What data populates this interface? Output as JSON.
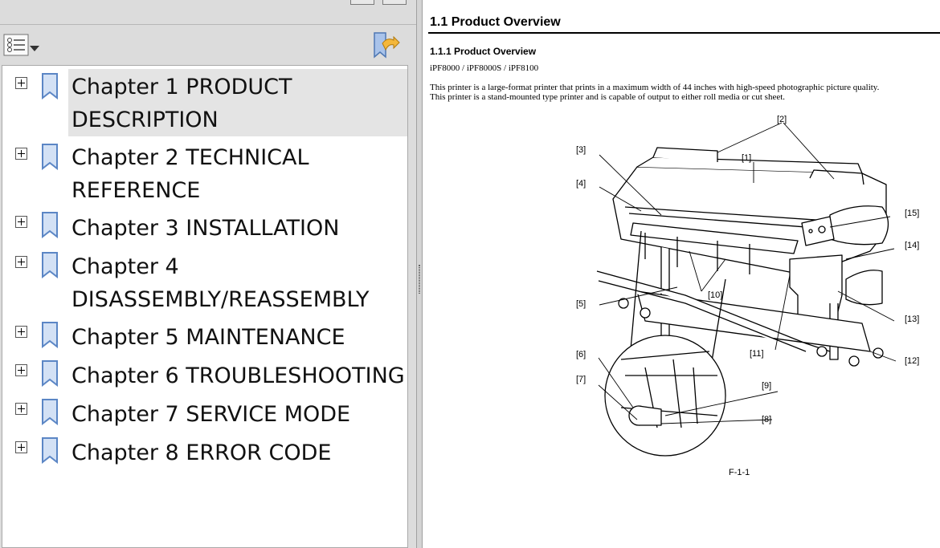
{
  "bookmarks": {
    "items": [
      {
        "label": "Chapter 1 PRODUCT DESCRIPTION",
        "selected": true
      },
      {
        "label": "Chapter 2 TECHNICAL REFERENCE"
      },
      {
        "label": "Chapter 3 INSTALLATION"
      },
      {
        "label": "Chapter 4 DISASSEMBLY/REASSEMBLY"
      },
      {
        "label": "Chapter 5 MAINTENANCE"
      },
      {
        "label": "Chapter 6 TROUBLESHOOTING"
      },
      {
        "label": "Chapter 7 SERVICE MODE"
      },
      {
        "label": "Chapter 8 ERROR CODE"
      }
    ],
    "icons": {
      "options": "list-options-icon",
      "expand": "expand-bookmark-icon",
      "bookmark": "bookmark-ribbon-icon"
    }
  },
  "document": {
    "section_title": "1.1 Product Overview",
    "subsection_title": "1.1.1 Product Overview",
    "models": "iPF8000 / iPF8000S / iPF8100",
    "description_line1": "This printer is a large-format printer that prints in a maximum width of 44 inches with high-speed photographic picture quality.",
    "description_line2": "This printer is a stand-mounted type printer and is capable of output to either roll media or cut sheet.",
    "figure": {
      "callouts": [
        "[1]",
        "[2]",
        "[3]",
        "[4]",
        "[5]",
        "[6]",
        "[7]",
        "[8]",
        "[9]",
        "[10]",
        "[11]",
        "[12]",
        "[13]",
        "[14]",
        "[15]"
      ],
      "caption": "F-1-1"
    }
  },
  "colors": {
    "panel_bg": "#dcdcdc",
    "tree_bg": "#ffffff",
    "bookmark_icon": "#5b86c5",
    "selected_bg": "#e4e4e4"
  }
}
